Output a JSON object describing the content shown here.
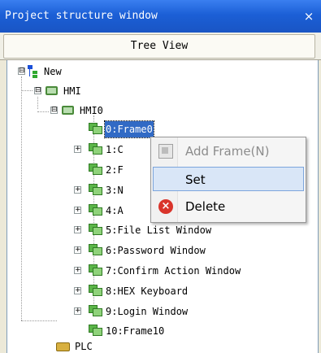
{
  "window": {
    "title": "Project structure window",
    "close_glyph": "×"
  },
  "tabs": [
    {
      "label": "Tree View"
    }
  ],
  "tree": {
    "root": {
      "label": "New",
      "expander": "⊟"
    },
    "hmi": {
      "label": "HMI",
      "expander": "⊟"
    },
    "hmi0": {
      "label": "HMI0",
      "expander": "⊟"
    },
    "frames": [
      {
        "label": "0:Frame0",
        "expander": "",
        "selected": true
      },
      {
        "label": "1:C",
        "expander": "+"
      },
      {
        "label": "2:F",
        "expander": ""
      },
      {
        "label": "3:N",
        "expander": "+"
      },
      {
        "label": "4:A",
        "expander": "+"
      },
      {
        "label": "5:File List Window",
        "expander": "+"
      },
      {
        "label": "6:Password Window",
        "expander": "+"
      },
      {
        "label": "7:Confirm Action Window",
        "expander": "+"
      },
      {
        "label": "8:HEX Keyboard",
        "expander": "+"
      },
      {
        "label": "9:Login Window",
        "expander": "+"
      },
      {
        "label": "10:Frame10",
        "expander": ""
      }
    ],
    "plc": {
      "label": "PLC"
    }
  },
  "context_menu": {
    "items": [
      {
        "label": "Add Frame(N)",
        "icon": "add-frame-icon",
        "disabled": true
      },
      {
        "label": "Set",
        "icon": "",
        "highlighted": true
      },
      {
        "label": "Delete",
        "icon": "delete-icon"
      }
    ]
  },
  "colors": {
    "titlebar": "#1b5fd6",
    "selection": "#316ac5",
    "menu_highlight": "#d9e6f7"
  }
}
